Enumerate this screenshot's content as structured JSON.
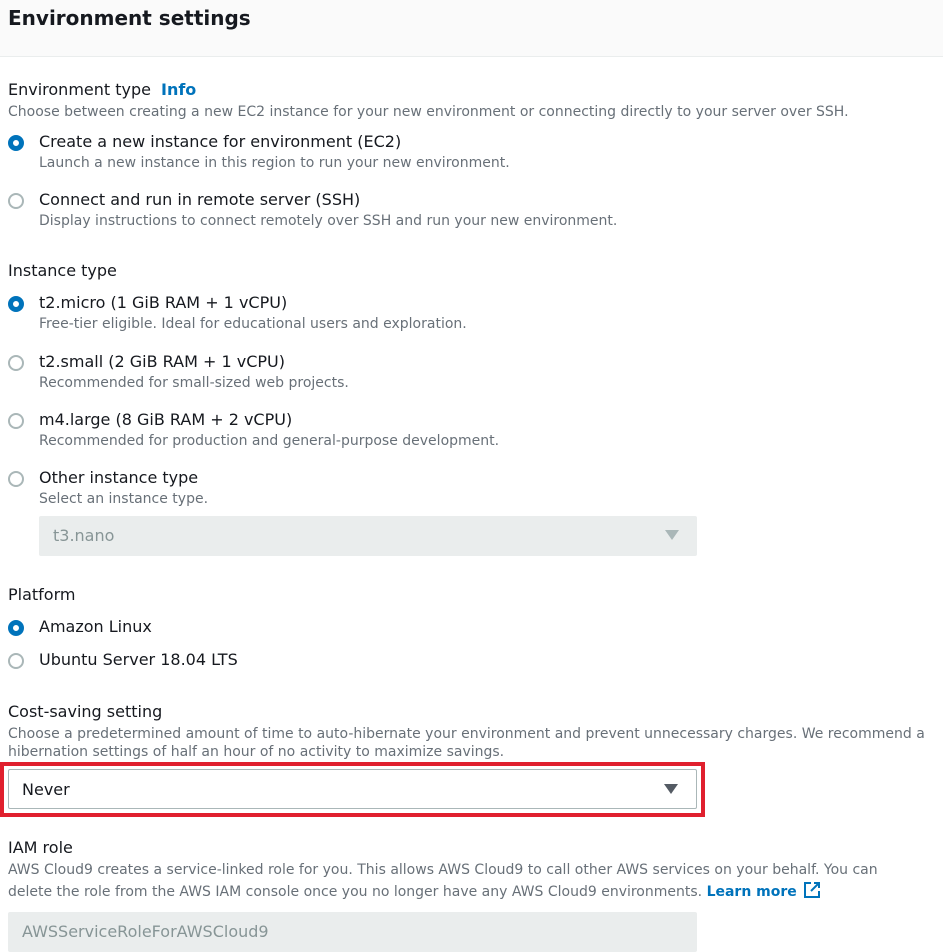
{
  "header": {
    "title": "Environment settings"
  },
  "environment_type": {
    "label": "Environment type",
    "info_link": "Info",
    "description": "Choose between creating a new EC2 instance for your new environment or connecting directly to your server over SSH.",
    "options": [
      {
        "label": "Create a new instance for environment (EC2)",
        "description": "Launch a new instance in this region to run your new environment.",
        "selected": true
      },
      {
        "label": "Connect and run in remote server (SSH)",
        "description": "Display instructions to connect remotely over SSH and run your new environment.",
        "selected": false
      }
    ]
  },
  "instance_type": {
    "label": "Instance type",
    "options": [
      {
        "label": "t2.micro (1 GiB RAM + 1 vCPU)",
        "description": "Free-tier eligible. Ideal for educational users and exploration.",
        "selected": true
      },
      {
        "label": "t2.small (2 GiB RAM + 1 vCPU)",
        "description": "Recommended for small-sized web projects.",
        "selected": false
      },
      {
        "label": "m4.large (8 GiB RAM + 2 vCPU)",
        "description": "Recommended for production and general-purpose development.",
        "selected": false
      },
      {
        "label": "Other instance type",
        "description": "Select an instance type.",
        "selected": false
      }
    ],
    "other_select_value": "t3.nano"
  },
  "platform": {
    "label": "Platform",
    "options": [
      {
        "label": "Amazon Linux",
        "selected": true
      },
      {
        "label": "Ubuntu Server 18.04 LTS",
        "selected": false
      }
    ]
  },
  "cost_saving": {
    "label": "Cost-saving setting",
    "description_line1": "Choose a predetermined amount of time to auto-hibernate your environment and prevent unnecessary charges. We recommend a",
    "description_line2": "hibernation settings of half an hour of no activity to maximize savings.",
    "selected_value": "Never"
  },
  "iam_role": {
    "label": "IAM role",
    "description_line1": "AWS Cloud9 creates a service-linked role for you. This allows AWS Cloud9 to call other AWS services on your behalf. You can",
    "description_line2": "delete the role from the AWS IAM console once you no longer have any AWS Cloud9 environments.",
    "learn_more": "Learn more",
    "value": "AWSServiceRoleForAWSCloud9"
  },
  "colors": {
    "accent": "#0073bb",
    "highlight": "#e0202e"
  },
  "icons": {
    "external_link": "external-link-icon",
    "caret": "caret-down-icon"
  }
}
